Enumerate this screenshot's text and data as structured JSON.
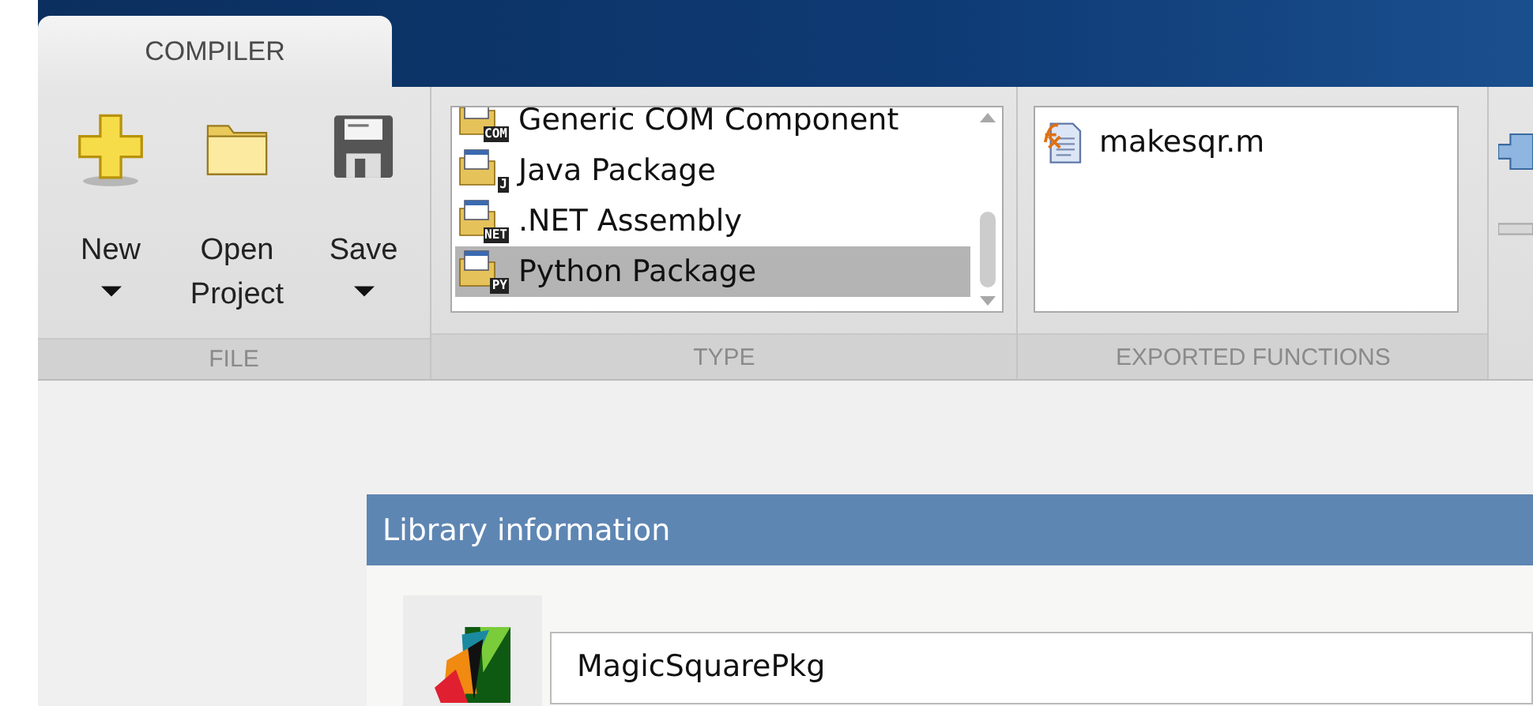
{
  "tabs": [
    {
      "label": "COMPILER",
      "selected": true
    }
  ],
  "ribbon": {
    "file": {
      "label": "FILE",
      "buttons": [
        {
          "kind": "new",
          "label": "New",
          "dropdown": true
        },
        {
          "kind": "open",
          "label": "Open Project",
          "dropdown": false
        },
        {
          "kind": "save",
          "label": "Save",
          "dropdown": true
        }
      ]
    },
    "type": {
      "label": "TYPE",
      "items": [
        {
          "label": "Generic COM Component",
          "badge": "COM",
          "selected": false
        },
        {
          "label": "Java Package",
          "badge": "J",
          "selected": false
        },
        {
          "label": ".NET Assembly",
          "badge": "NET",
          "selected": false
        },
        {
          "label": "Python Package",
          "badge": "PY",
          "selected": true
        }
      ]
    },
    "exported_functions": {
      "label": "EXPORTED FUNCTIONS",
      "files": [
        "makesqr.m"
      ]
    }
  },
  "library_information": {
    "title": "Library information",
    "name": "MagicSquarePkg"
  }
}
